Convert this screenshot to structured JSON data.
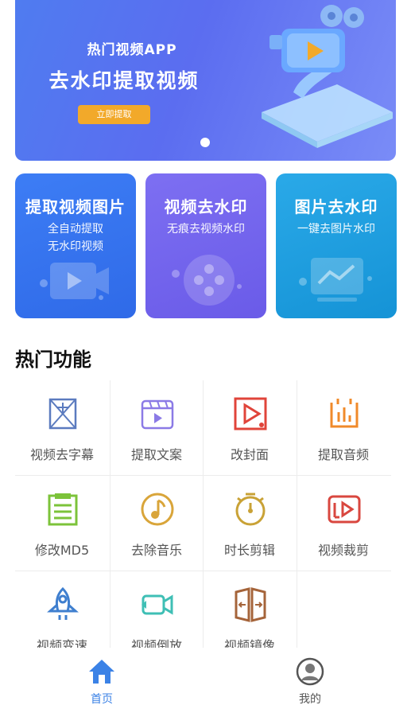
{
  "banner": {
    "subtitle": "热门视频APP",
    "title": "去水印提取视频",
    "button_label": "立即提取"
  },
  "cards": [
    {
      "title": "提取视频图片",
      "lines": [
        "全自动提取",
        "无水印视频"
      ],
      "icon": "video-camera-icon"
    },
    {
      "title": "视频去水印",
      "lines": [
        "无痕去视频水印"
      ],
      "icon": "film-reel-icon"
    },
    {
      "title": "图片去水印",
      "lines": [
        "一键去图片水印"
      ],
      "icon": "line-chart-icon"
    }
  ],
  "section_title": "热门功能",
  "features": [
    {
      "label": "视频去字幕",
      "icon": "remove-subtitle-icon",
      "color": "#5b7bbf"
    },
    {
      "label": "提取文案",
      "icon": "clapperboard-icon",
      "color": "#8b7ae6"
    },
    {
      "label": "改封面",
      "icon": "cover-play-icon",
      "color": "#e0443a"
    },
    {
      "label": "提取音频",
      "icon": "audio-bars-icon",
      "color": "#f08a2a"
    },
    {
      "label": "修改MD5",
      "icon": "document-icon",
      "color": "#7cc33a"
    },
    {
      "label": "去除音乐",
      "icon": "music-note-icon",
      "color": "#d9a53a"
    },
    {
      "label": "时长剪辑",
      "icon": "stopwatch-icon",
      "color": "#c9a236"
    },
    {
      "label": "视频裁剪",
      "icon": "video-crop-icon",
      "color": "#d9473f"
    },
    {
      "label": "视频变速",
      "icon": "rocket-icon",
      "color": "#3f7fcf"
    },
    {
      "label": "视频倒放",
      "icon": "reverse-camera-icon",
      "color": "#3fbfb5"
    },
    {
      "label": "视频镜像",
      "icon": "mirror-door-icon",
      "color": "#a5643a"
    }
  ],
  "nav": [
    {
      "label": "首页",
      "icon": "home-icon",
      "color": "#3b82e6",
      "active": true
    },
    {
      "label": "我的",
      "icon": "user-avatar-icon",
      "color": "#555555",
      "active": false
    }
  ]
}
